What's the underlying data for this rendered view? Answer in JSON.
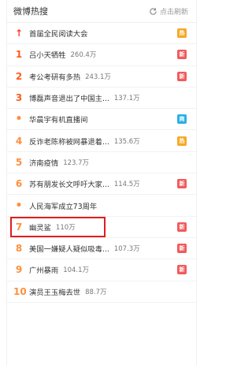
{
  "header": {
    "title": "微博热搜",
    "refresh_label": "点击刷新"
  },
  "items": [
    {
      "rank": "↑",
      "rank_type": "top",
      "text": "首届全民阅读大会",
      "count": "",
      "badge": "热",
      "badge_type": "hot"
    },
    {
      "rank": "1",
      "rank_type": "r1",
      "text": "吕小天牺牲",
      "count": "260.4万",
      "badge": "新",
      "badge_type": "new"
    },
    {
      "rank": "2",
      "rank_type": "r2",
      "text": "考公考研有多热",
      "count": "243.1万",
      "badge": "新",
      "badge_type": "new"
    },
    {
      "rank": "3",
      "rank_type": "r3",
      "text": "博磊声音退出了中国主...",
      "count": "137.1万",
      "badge": "",
      "badge_type": ""
    },
    {
      "rank": "•",
      "rank_type": "dot",
      "text": "华晨宇有机直播间",
      "count": "",
      "badge": "商",
      "badge_type": "live"
    },
    {
      "rank": "4",
      "rank_type": "r4",
      "text": "反诈老陈称被网暴退着...",
      "count": "135.6万",
      "badge": "热",
      "badge_type": "hot"
    },
    {
      "rank": "5",
      "rank_type": "r5",
      "text": "济南疫情",
      "count": "123.7万",
      "badge": "",
      "badge_type": ""
    },
    {
      "rank": "6",
      "rank_type": "r6",
      "text": "苏有朋发长文呼吁大家...",
      "count": "114.5万",
      "badge": "新",
      "badge_type": "new"
    },
    {
      "rank": "•",
      "rank_type": "dot",
      "text": "人民海军成立73周年",
      "count": "",
      "badge": "",
      "badge_type": ""
    },
    {
      "rank": "7",
      "rank_type": "r7",
      "text": "幽灵鲨",
      "count": "110万",
      "badge": "新",
      "badge_type": "new",
      "highlight": true
    },
    {
      "rank": "8",
      "rank_type": "r8",
      "text": "美国一嫌疑人疑似吸毒...",
      "count": "107.3万",
      "badge": "新",
      "badge_type": "new"
    },
    {
      "rank": "9",
      "rank_type": "r9",
      "text": "广州暴雨",
      "count": "104.1万",
      "badge": "新",
      "badge_type": "new"
    },
    {
      "rank": "10",
      "rank_type": "r10",
      "text": "演员王玉梅去世",
      "count": "88.7万",
      "badge": "",
      "badge_type": ""
    }
  ]
}
